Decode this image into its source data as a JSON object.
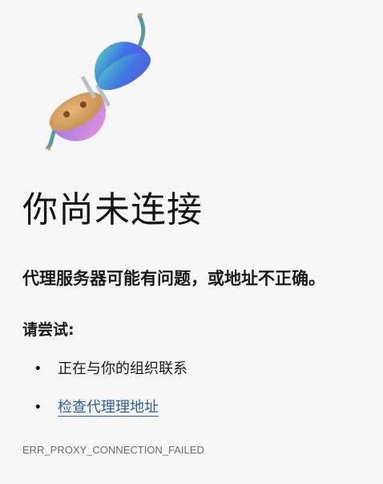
{
  "page": {
    "title": "你尚未连接",
    "message": "代理服务器可能有问题，或地址不正确。",
    "try_heading": "请尝试:",
    "suggestions": [
      {
        "text": "正在与你的组织联系",
        "is_link": false
      },
      {
        "text": "检查代理理地址",
        "is_link": true
      }
    ],
    "error_code": "ERR_PROXY_CONNECTION_FAILED"
  },
  "illustration": {
    "icon": "unplugged-connector-icon",
    "colors": {
      "sphere_left_gradient": [
        "#a77ee8",
        "#e08fd9"
      ],
      "plug_face": "#d9a566",
      "sphere_right_gradient": [
        "#4fd6b0",
        "#3a6ee6",
        "#6a4fe0"
      ],
      "cord": "#5a9aa0"
    }
  },
  "colors": {
    "background": "#f7f7f7",
    "text": "#1a1a1a",
    "link": "#2b5f99",
    "muted": "#6b6b6b"
  }
}
